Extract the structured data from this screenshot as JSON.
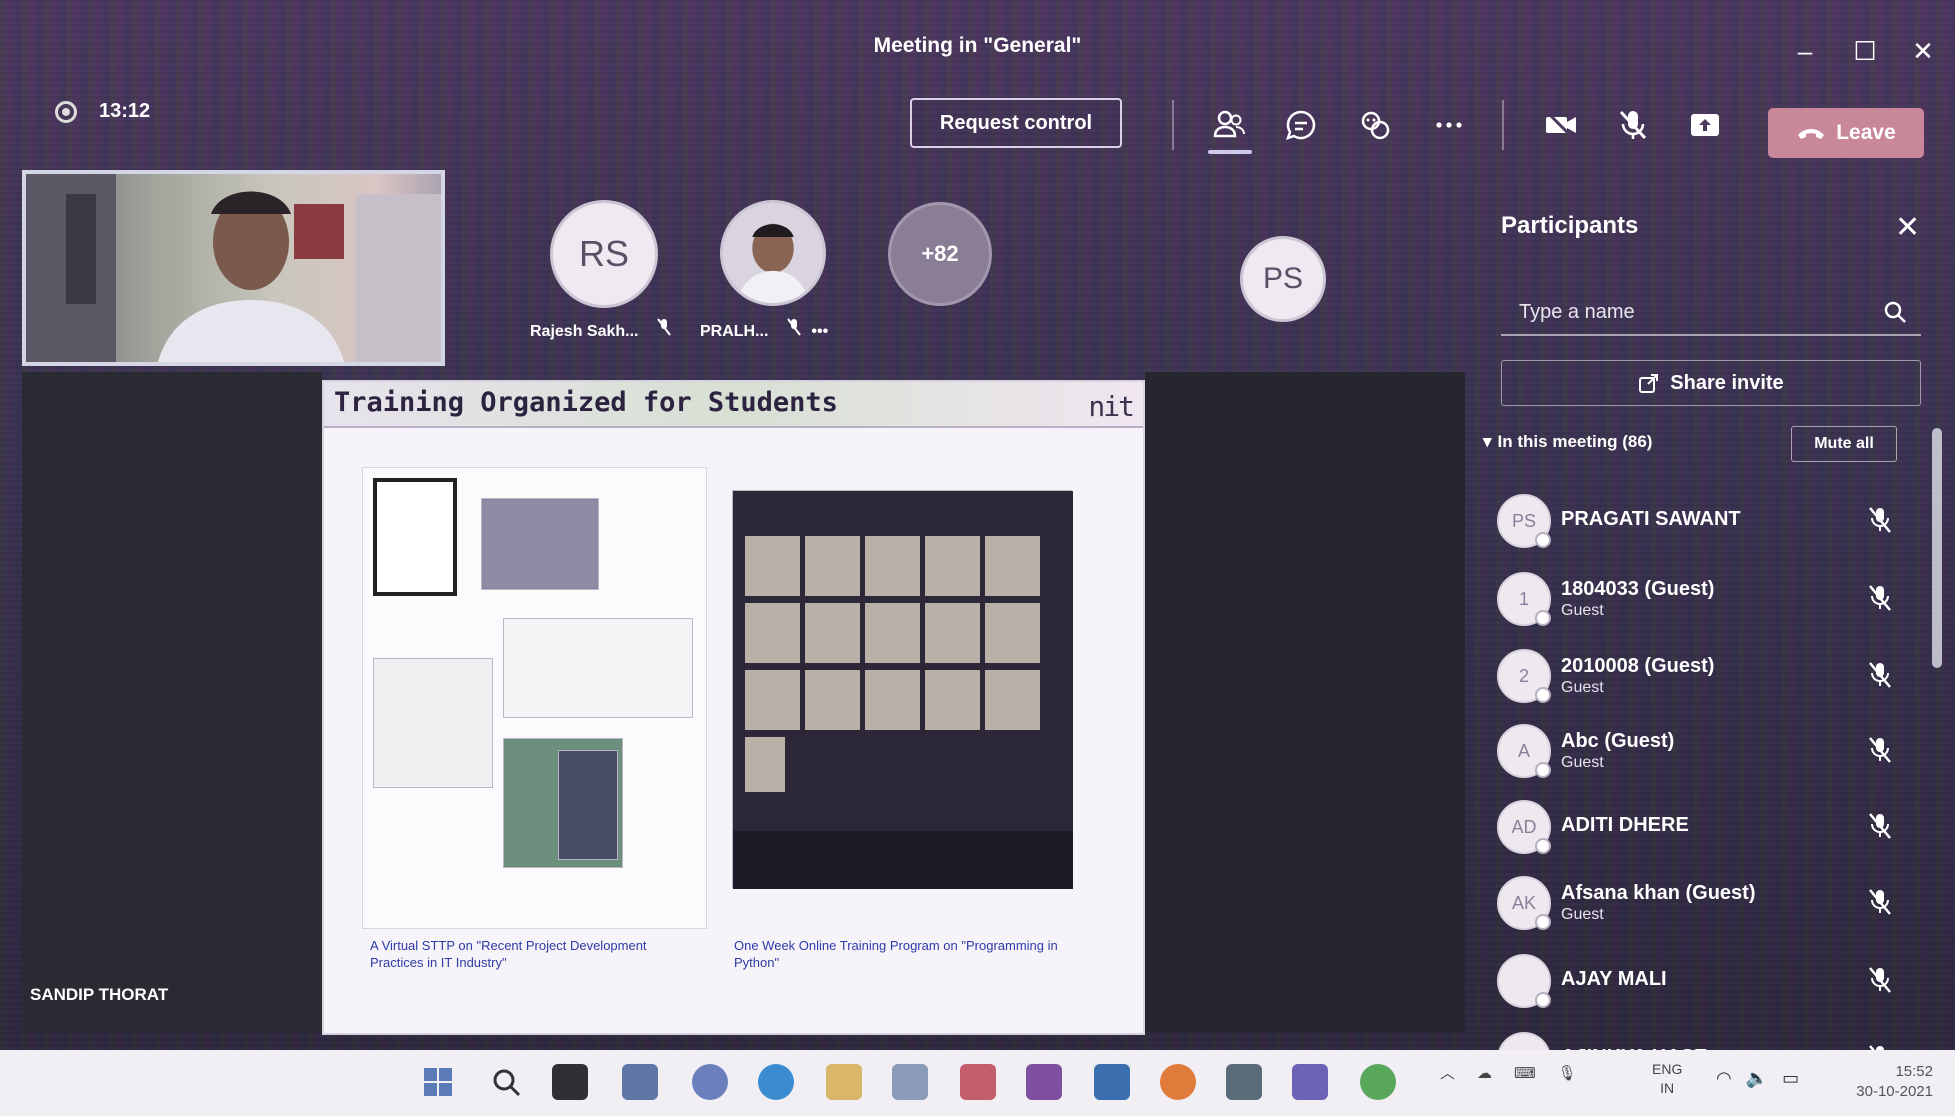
{
  "window": {
    "title": "Meeting in \"General\""
  },
  "meeting": {
    "elapsed": "13:12",
    "request_control_label": "Request control",
    "leave_label": "Leave"
  },
  "stage": {
    "tiles": [
      {
        "initials": "RS",
        "name": "Rajesh Sakh..."
      },
      {
        "initials": "",
        "name": "PRALH..."
      },
      {
        "initials": "+82",
        "name": ""
      },
      {
        "initials": "PS",
        "name": ""
      }
    ],
    "speaker_name": "SANDIP THORAT"
  },
  "slide": {
    "title": "Training Organized for Students",
    "logo": "nit",
    "caption_left": "A Virtual STTP on \"Recent Project Development Practices in IT Industry\"",
    "caption_right": "One Week Online Training Program on \"Programming in Python\""
  },
  "participants": {
    "title": "Participants",
    "search_placeholder": "Type a name",
    "share_invite_label": "Share invite",
    "section_label": "In this meeting (86)",
    "mute_all_label": "Mute all",
    "list": [
      {
        "initials": "PS",
        "name": "PRAGATI SAWANT",
        "role": ""
      },
      {
        "initials": "1",
        "name": "1804033 (Guest)",
        "role": "Guest"
      },
      {
        "initials": "2",
        "name": "2010008 (Guest)",
        "role": "Guest"
      },
      {
        "initials": "A",
        "name": "Abc (Guest)",
        "role": "Guest"
      },
      {
        "initials": "AD",
        "name": "ADITI DHERE",
        "role": ""
      },
      {
        "initials": "AK",
        "name": "Afsana khan (Guest)",
        "role": "Guest"
      },
      {
        "initials": "",
        "name": "AJAY MALI",
        "role": ""
      },
      {
        "initials": "",
        "name": "AJINKYA HASE",
        "role": ""
      }
    ]
  },
  "taskbar": {
    "lang_line1": "ENG",
    "lang_line2": "IN",
    "time": "15:52",
    "date": "30-10-2021"
  },
  "colors": {
    "leave": "#c9879a",
    "panel_text": "#ffffff",
    "taskbar": "#f1eef4"
  }
}
